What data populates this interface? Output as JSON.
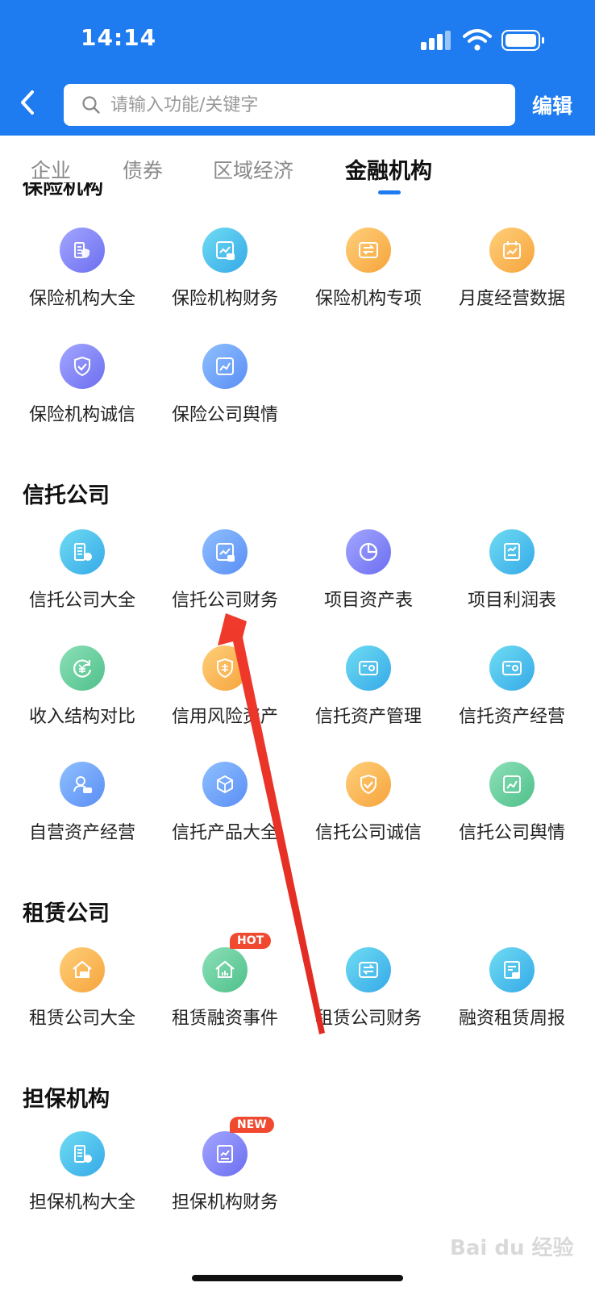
{
  "status": {
    "time": "14:14"
  },
  "search": {
    "placeholder": "请输入功能/关键字"
  },
  "header": {
    "edit_label": "编辑"
  },
  "tabs": [
    {
      "label": "企业",
      "active": false
    },
    {
      "label": "债券",
      "active": false
    },
    {
      "label": "区域经济",
      "active": false
    },
    {
      "label": "金融机构",
      "active": true
    }
  ],
  "clipped_section_title": "保险机构",
  "insurance": {
    "items": [
      {
        "label": "保险机构大全",
        "icon": "building-shield-icon",
        "color": "purple"
      },
      {
        "label": "保险机构财务",
        "icon": "chart-insurance-icon",
        "color": "cyan"
      },
      {
        "label": "保险机构专项",
        "icon": "transfer-insurance-icon",
        "color": "orange"
      },
      {
        "label": "月度经营数据",
        "icon": "calendar-chart-icon",
        "color": "orange"
      },
      {
        "label": "保险机构诚信",
        "icon": "shield-check-icon",
        "color": "purple"
      },
      {
        "label": "保险公司舆情",
        "icon": "sentiment-chart-icon",
        "color": "blue"
      }
    ]
  },
  "trust": {
    "title": "信托公司",
    "items": [
      {
        "label": "信托公司大全",
        "icon": "building-trust-icon",
        "color": "cyan"
      },
      {
        "label": "信托公司财务",
        "icon": "chart-trust-icon",
        "color": "blue"
      },
      {
        "label": "项目资产表",
        "icon": "pie-chart-icon",
        "color": "purple"
      },
      {
        "label": "项目利润表",
        "icon": "report-chart-icon",
        "color": "cyan"
      },
      {
        "label": "收入结构对比",
        "icon": "yuan-cycle-icon",
        "color": "green"
      },
      {
        "label": "信用风险资产",
        "icon": "credit-shield-icon",
        "color": "orange"
      },
      {
        "label": "信托资产管理",
        "icon": "wallet-icon",
        "color": "cyan"
      },
      {
        "label": "信托资产经营",
        "icon": "wallet-icon",
        "color": "cyan"
      },
      {
        "label": "自营资产经营",
        "icon": "self-operated-icon",
        "color": "blue"
      },
      {
        "label": "信托产品大全",
        "icon": "cube-trust-icon",
        "color": "blue"
      },
      {
        "label": "信托公司诚信",
        "icon": "shield-trust-icon",
        "color": "orange"
      },
      {
        "label": "信托公司舆情",
        "icon": "sentiment-trust-icon",
        "color": "green"
      }
    ]
  },
  "leasing": {
    "title": "租赁公司",
    "items": [
      {
        "label": "租赁公司大全",
        "icon": "house-lease-icon",
        "color": "orange"
      },
      {
        "label": "租赁融资事件",
        "icon": "house-chart-icon",
        "color": "green",
        "badge": "HOT"
      },
      {
        "label": "租赁公司财务",
        "icon": "transfer-lease-icon",
        "color": "cyan"
      },
      {
        "label": "融资租赁周报",
        "icon": "weekly-report-icon",
        "color": "cyan"
      }
    ]
  },
  "guarantee": {
    "title": "担保机构",
    "items": [
      {
        "label": "担保机构大全",
        "icon": "building-guarantee-icon",
        "color": "cyan"
      },
      {
        "label": "担保机构财务",
        "icon": "document-chart-icon",
        "color": "purple",
        "badge": "NEW"
      }
    ]
  },
  "annotation": {
    "arrow_color": "#e8332a",
    "arrow_points_to": "信托公司财务"
  },
  "watermark": "Bai du 经验"
}
